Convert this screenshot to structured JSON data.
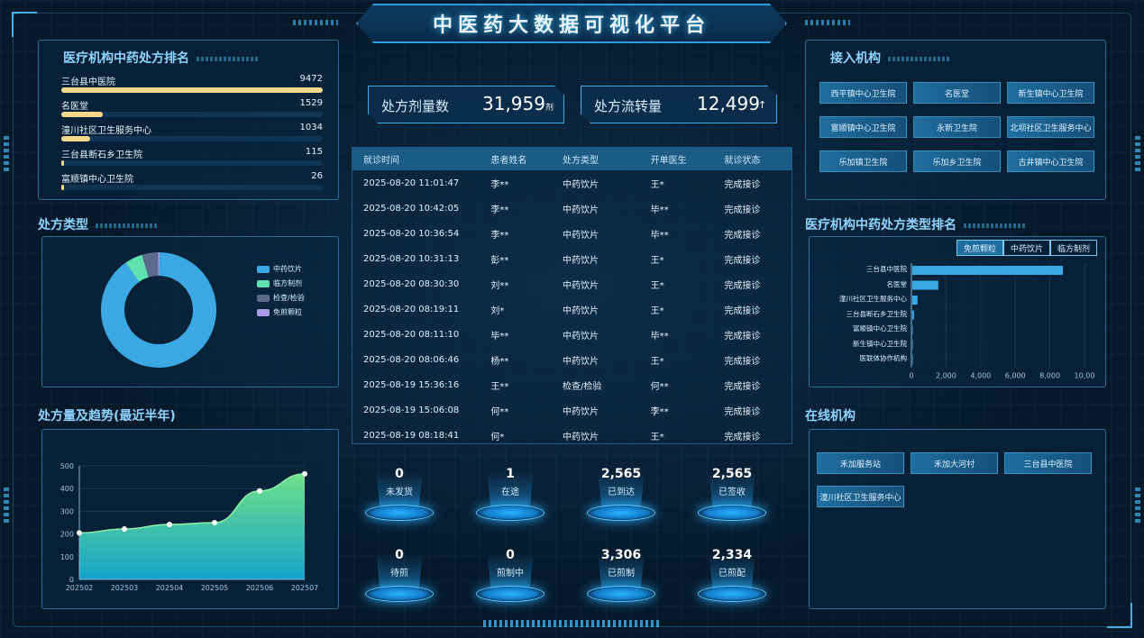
{
  "title": "中医药大数据可视化平台",
  "ranking": {
    "title": "医疗机构中药处方排名",
    "items": [
      {
        "name": "三台县中医院",
        "value": "9472",
        "ratio": 1.0
      },
      {
        "name": "名医堂",
        "value": "1529",
        "ratio": 0.16
      },
      {
        "name": "潼川社区卫生服务中心",
        "value": "1034",
        "ratio": 0.11
      },
      {
        "name": "三台县断石乡卫生院",
        "value": "115",
        "ratio": 0.012
      },
      {
        "name": "富顺镇中心卫生院",
        "value": "26",
        "ratio": 0.003
      }
    ]
  },
  "rx_type": {
    "title": "处方类型",
    "legend": [
      "中药饮片",
      "临方制剂",
      "检查/检验",
      "免煎颗粒"
    ],
    "colors": [
      "#3aa9e3",
      "#5fe0b0",
      "#5a6b8c",
      "#a99be8"
    ],
    "values": [
      90,
      5,
      4.5,
      0.5
    ]
  },
  "trend": {
    "title": "处方量及趋势(最近半年)",
    "chart_data": {
      "type": "area",
      "x": [
        "202502",
        "202503",
        "202504",
        "202505",
        "202506",
        "202507"
      ],
      "values": [
        205,
        222,
        242,
        250,
        390,
        465
      ],
      "ylim": [
        0,
        500
      ],
      "yticks": [
        "0",
        "100",
        "200",
        "300",
        "400",
        "500"
      ]
    }
  },
  "stats": {
    "dose_label": "处方剂量数",
    "dose_value": "31,959",
    "dose_unit": "剂",
    "flow_label": "处方流转量",
    "flow_value": "12,499",
    "flow_arrow": "↑"
  },
  "table": {
    "headers": [
      "就诊时间",
      "患者姓名",
      "处方类型",
      "开单医生",
      "就诊状态"
    ],
    "rows": [
      [
        "2025-08-20 11:01:47",
        "李**",
        "中药饮片",
        "王*",
        "完成接诊"
      ],
      [
        "2025-08-20 10:42:05",
        "李**",
        "中药饮片",
        "毕**",
        "完成接诊"
      ],
      [
        "2025-08-20 10:36:54",
        "李**",
        "中药饮片",
        "毕**",
        "完成接诊"
      ],
      [
        "2025-08-20 10:31:13",
        "彭**",
        "中药饮片",
        "王*",
        "完成接诊"
      ],
      [
        "2025-08-20 08:30:30",
        "刘**",
        "中药饮片",
        "王*",
        "完成接诊"
      ],
      [
        "2025-08-20 08:19:11",
        "刘*",
        "中药饮片",
        "王*",
        "完成接诊"
      ],
      [
        "2025-08-20 08:11:10",
        "毕**",
        "中药饮片",
        "毕**",
        "完成接诊"
      ],
      [
        "2025-08-20 08:06:46",
        "杨**",
        "中药饮片",
        "王*",
        "完成接诊"
      ],
      [
        "2025-08-19 15:36:16",
        "王**",
        "检查/检验",
        "何**",
        "完成接诊"
      ],
      [
        "2025-08-19 15:06:08",
        "何**",
        "中药饮片",
        "李**",
        "完成接诊"
      ],
      [
        "2025-08-19 08:18:41",
        "何*",
        "中药饮片",
        "王*",
        "完成接诊"
      ]
    ]
  },
  "logistics": [
    {
      "num": "0",
      "label": "未发货"
    },
    {
      "num": "1",
      "label": "在途"
    },
    {
      "num": "2,565",
      "label": "已到达"
    },
    {
      "num": "2,565",
      "label": "已签收"
    },
    {
      "num": "0",
      "label": "待煎"
    },
    {
      "num": "0",
      "label": "煎制中"
    },
    {
      "num": "3,306",
      "label": "已煎制"
    },
    {
      "num": "2,334",
      "label": "已煎配"
    }
  ],
  "access": {
    "title": "接入机构",
    "items": [
      "西平镇中心卫生院",
      "名医堂",
      "新生镇中心卫生院",
      "富顺镇中心卫生院",
      "永新卫生院",
      "北坝社区卫生服务中心",
      "乐加镇卫生院",
      "乐加乡卫生院",
      "古井镇中心卫生院"
    ]
  },
  "type_rank": {
    "title": "医疗机构中药处方类型排名",
    "tabs": [
      "免煎颗粒",
      "中药饮片",
      "临方制剂"
    ],
    "labels": [
      "三台县中医院",
      "名医堂",
      "潼川社区卫生服务中心",
      "三台县断石乡卫生院",
      "富顺镇中心卫生院",
      "新生镇中心卫生院",
      "医联体协作机构"
    ],
    "chart_data": {
      "type": "bar",
      "values": [
        8700,
        1500,
        300,
        100,
        20,
        10,
        0
      ],
      "xlim": [
        0,
        10000
      ],
      "xticks": [
        "0",
        "2,000",
        "4,000",
        "6,000",
        "8,000",
        "10,00"
      ]
    }
  },
  "online": {
    "title": "在线机构",
    "items": [
      "禾加服务站",
      "禾加大河村",
      "三台县中医院",
      "潼川社区卫生服务中心"
    ]
  }
}
